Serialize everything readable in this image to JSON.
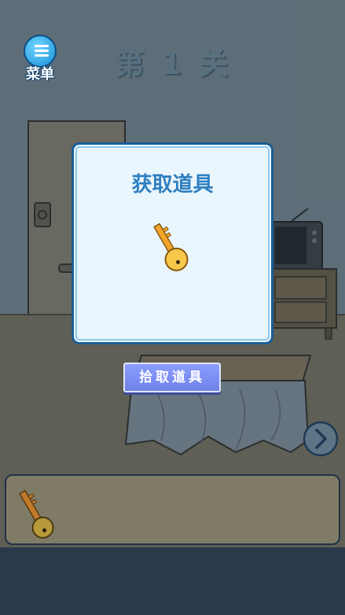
{
  "header": {
    "menu_label": "菜单",
    "level_title": "第 1 关"
  },
  "dialog": {
    "title": "获取道具",
    "item_icon": "key-icon",
    "pickup_label": "拾取道具"
  },
  "navigation": {
    "next_icon": "chevron-right-icon"
  },
  "inventory": {
    "items": [
      {
        "icon": "key-icon"
      }
    ]
  },
  "colors": {
    "wall": "#7c8d96",
    "floor": "#7d7662",
    "dialog_bg": "#eaf6fd",
    "dialog_border": "#1b5e95",
    "dialog_title": "#2e7fc0",
    "button": "#7d8ff2",
    "key": "#f5c23a"
  }
}
